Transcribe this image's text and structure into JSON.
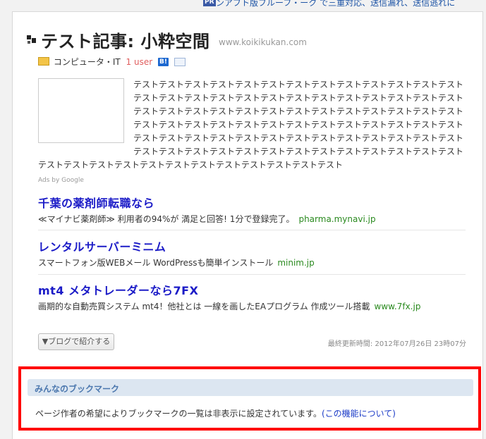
{
  "topbar": {
    "pr_badge": "PR",
    "text": "ンアブト版ブルーフ・ーク で三重対応、送信漏れ、送信逃れに"
  },
  "article": {
    "title": "テスト記事: 小粋空間",
    "domain": "www.koikikukan.com",
    "category": "コンピュータ・IT",
    "users": "1 user",
    "b_badge": "B!",
    "description": "テストテストテストテストテストテストテストテストテストテストテストテストテストテストテストテストテストテストテストテストテストテストテストテストテストテストテストテストテストテストテストテストテストテストテストテストテストテストテストテストテストテストテストテストテストテストテストテストテストテストテストテストテストテストテストテストテストテストテストテストテストテストテストテストテストテストテストテストテストテストテストテストテストテストテストテストテストテストテストテストテストテストテストテストテストテストテストテストテストテスト"
  },
  "ads": {
    "label": "Ads by Google",
    "items": [
      {
        "title": "千葉の薬剤師転職なら",
        "body": "≪マイナビ薬剤師≫ 利用者の94%が 満足と回答! 1分で登録完了。",
        "url": "pharma.mynavi.jp"
      },
      {
        "title": "レンタルサーバーミニム",
        "body": "スマートフォン版WEBメール WordPressも簡単インストール",
        "url": "minim.jp"
      },
      {
        "title": "mt4 メタトレーダーなら7FX",
        "body": "画期的な自動売買システム mt4！他社とは 一線を画したEAプログラム 作成ツール搭載",
        "url": "www.7fx.jp"
      }
    ]
  },
  "share_button": "▼ブログで紹介する",
  "last_updated": "最終更新時間: 2012年07月26日 23時07分",
  "bookmarks": {
    "title": "みんなのブックマーク",
    "message": "ページ作者の希望によりブックマークの一覧は非表示に設定されています。",
    "link_text": "(この機能について)"
  }
}
